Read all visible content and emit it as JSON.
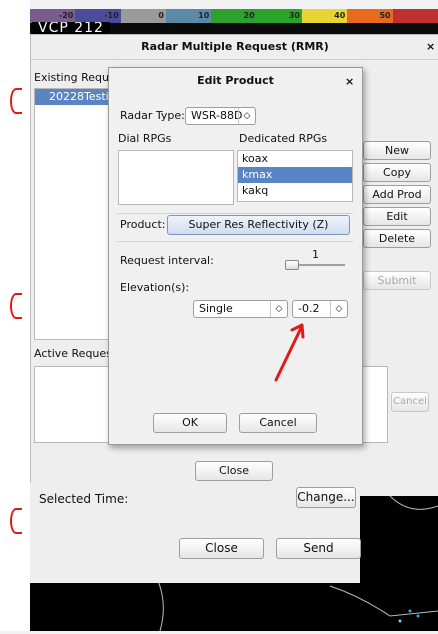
{
  "colorbar": {
    "ticks": [
      "-20",
      "-10",
      "0",
      "10",
      "20",
      "30",
      "40",
      "50"
    ],
    "colors": [
      "#7a5d8e",
      "#4b4c9a",
      "#9a9a9a",
      "#5a8aa8",
      "#2ea12e",
      "#2aa52a",
      "#e8d534",
      "#e86a1c",
      "#c03030"
    ]
  },
  "vcp_text": "VCP 212",
  "rmr": {
    "title": "Radar Multiple Request (RMR)",
    "close_x": "×",
    "existing_label": "Existing Reques",
    "existing_items": [
      "20228Testi"
    ],
    "buttons": {
      "new_request": "New Request",
      "copy": "Copy",
      "add_prod": "Add Prod",
      "edit": "Edit",
      "delete": "Delete",
      "submit": "Submit",
      "cancel": "Cancel",
      "close": "Close"
    },
    "active_label": "Active Requests"
  },
  "edit_product": {
    "title": "Edit Product",
    "close_x": "×",
    "radar_type_label": "Radar Type:",
    "radar_type_value": "WSR-88D",
    "dial_rpgs_label": "Dial RPGs",
    "dedicated_rpgs_label": "Dedicated RPGs",
    "dedicated_rpgs": [
      "koax",
      "kmax",
      "kakq"
    ],
    "selected_rpg": "kmax",
    "product_label": "Product:",
    "product_value": "Super Res Reflectivity (Z)",
    "request_interval_label": "Request interval:",
    "request_interval_value": "1",
    "elevation_label": "Elevation(s):",
    "elevation_mode": "Single",
    "elevation_value": "-0.2",
    "ok": "OK",
    "cancel": "Cancel"
  },
  "lower": {
    "selected_time_label": "Selected Time:",
    "change_button": "Change...",
    "close_button": "Close",
    "send_button": "Send"
  }
}
